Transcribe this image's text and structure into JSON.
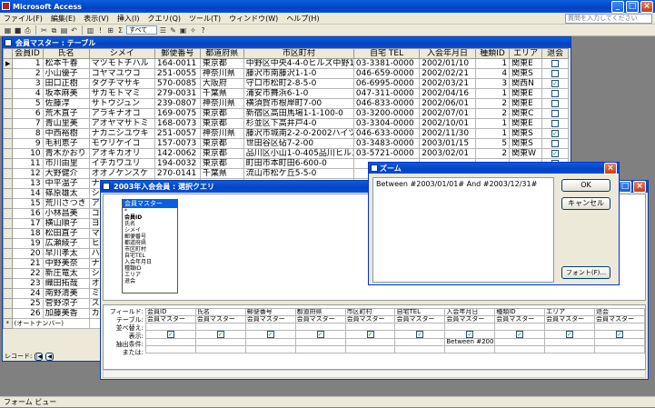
{
  "app": {
    "title": "Microsoft Access",
    "status": "フォーム ビュー"
  },
  "menu": [
    "ファイル(F)",
    "編集(E)",
    "表示(V)",
    "挿入(I)",
    "クエリ(Q)",
    "ツール(T)",
    "ウィンドウ(W)",
    "ヘルプ(H)"
  ],
  "help_placeholder": "質問を入力してください",
  "toolbar": {
    "select_value": "すべて"
  },
  "table_window": {
    "title": "会員マスター : テーブル",
    "columns": [
      "会員ID",
      "氏名",
      "シメイ",
      "郵便番号",
      "都道府県",
      "市区町村",
      "自宅 TEL",
      "入会年月日",
      "種類ID",
      "エリア",
      "退会"
    ],
    "rows": [
      {
        "id": "1",
        "name": "松本千春",
        "kana": "マツモトチハル",
        "zip": "164-0011",
        "pref": "東京都",
        "city": "中野区中央4-4-0ヒルズ中野10",
        "tel": "03-3381-0000",
        "date": "2002/01/10",
        "type": "1",
        "area": "関東E",
        "quit": false
      },
      {
        "id": "2",
        "name": "小山優子",
        "kana": "コヤマユウコ",
        "zip": "251-0055",
        "pref": "神奈川県",
        "city": "藤沢市南藤沢1-1-0",
        "tel": "046-659-0000",
        "date": "2002/02/21",
        "type": "4",
        "area": "関東S",
        "quit": false
      },
      {
        "id": "3",
        "name": "田口正樹",
        "kana": "タグチマサキ",
        "zip": "570-0085",
        "pref": "大阪府",
        "city": "守口市松町2-8-5-0",
        "tel": "06-6995-0000",
        "date": "2002/03/21",
        "type": "3",
        "area": "関西N",
        "quit": true
      },
      {
        "id": "4",
        "name": "坂本麻美",
        "kana": "サカモトマミ",
        "zip": "279-0031",
        "pref": "千葉県",
        "city": "浦安市舞浜6-1-0",
        "tel": "047-311-0000",
        "date": "2002/04/16",
        "type": "1",
        "area": "関東E",
        "quit": false
      },
      {
        "id": "5",
        "name": "佐藤淳",
        "kana": "サトウジュン",
        "zip": "239-0807",
        "pref": "神奈川県",
        "city": "横須賀市根岸町7-00",
        "tel": "046-833-0000",
        "date": "2002/06/01",
        "type": "2",
        "area": "関東E",
        "quit": false
      },
      {
        "id": "6",
        "name": "荒木直子",
        "kana": "アラキナオコ",
        "zip": "169-0075",
        "pref": "東京都",
        "city": "新宿区高田馬場1-1-100-0",
        "tel": "03-3200-0000",
        "date": "2002/07/01",
        "type": "2",
        "area": "関東C",
        "quit": false
      },
      {
        "id": "7",
        "name": "青山里美",
        "kana": "アオヤマサトミ",
        "zip": "168-0073",
        "pref": "東京都",
        "city": "杉並区下高井戸4-0",
        "tel": "03-3304-0000",
        "date": "2002/10/01",
        "type": "1",
        "area": "関東E",
        "quit": false
      },
      {
        "id": "8",
        "name": "中西裕樹",
        "kana": "ナカニシユウキ",
        "zip": "251-0057",
        "pref": "神奈川県",
        "city": "藤沢市城南2-2-0-2002ハイツ城",
        "tel": "046-633-0000",
        "date": "2002/11/30",
        "type": "1",
        "area": "関東S",
        "quit": true
      },
      {
        "id": "9",
        "name": "毛利恵子",
        "kana": "モウリケイコ",
        "zip": "157-0073",
        "pref": "東京都",
        "city": "世田谷区砧7-2-00",
        "tel": "03-3483-0000",
        "date": "2003/01/15",
        "type": "5",
        "area": "関東S",
        "quit": false
      },
      {
        "id": "10",
        "name": "青木かおり",
        "kana": "アオキカオリ",
        "zip": "142-0062",
        "pref": "東京都",
        "city": "品川区小山1-0-405品川ヒルズ",
        "tel": "03-5721-0000",
        "date": "2003/02/01",
        "type": "2",
        "area": "関東W",
        "quit": true
      },
      {
        "id": "11",
        "name": "市川由里",
        "kana": "イチカワユリ",
        "zip": "194-0032",
        "pref": "東京都",
        "city": "町田市本町田6-600-0",
        "tel": "",
        "date": "",
        "type": "",
        "area": "",
        "quit": false
      },
      {
        "id": "12",
        "name": "大野健介",
        "kana": "オオノケンスケ",
        "zip": "270-0141",
        "pref": "千葉県",
        "city": "流山市松ケ丘5-5-0",
        "tel": "",
        "date": "",
        "type": "",
        "area": "",
        "quit": false
      },
      {
        "id": "13",
        "name": "中平温子",
        "kana": "ナ",
        "zip": "",
        "pref": "",
        "city": "",
        "tel": "",
        "date": "",
        "type": "",
        "area": "",
        "quit": false
      },
      {
        "id": "14",
        "name": "篠原雄太",
        "kana": "シ",
        "zip": "",
        "pref": "",
        "city": "",
        "tel": "",
        "date": "",
        "type": "",
        "area": "",
        "quit": false
      },
      {
        "id": "15",
        "name": "荒川さつき",
        "kana": "ア",
        "zip": "",
        "pref": "",
        "city": "",
        "tel": "",
        "date": "",
        "type": "",
        "area": "",
        "quit": false
      },
      {
        "id": "16",
        "name": "小林昌美",
        "kana": "コ",
        "zip": "",
        "pref": "",
        "city": "",
        "tel": "",
        "date": "",
        "type": "",
        "area": "",
        "quit": false
      },
      {
        "id": "17",
        "name": "横山順子",
        "kana": "ヨ",
        "zip": "",
        "pref": "",
        "city": "",
        "tel": "",
        "date": "",
        "type": "",
        "area": "",
        "quit": false
      },
      {
        "id": "18",
        "name": "松田直子",
        "kana": "マ",
        "zip": "",
        "pref": "",
        "city": "",
        "tel": "",
        "date": "",
        "type": "",
        "area": "",
        "quit": false
      },
      {
        "id": "19",
        "name": "広瀬綾子",
        "kana": "ヒ",
        "zip": "",
        "pref": "",
        "city": "",
        "tel": "",
        "date": "",
        "type": "",
        "area": "",
        "quit": false
      },
      {
        "id": "20",
        "name": "早川孝太",
        "kana": "ハ",
        "zip": "",
        "pref": "",
        "city": "",
        "tel": "",
        "date": "",
        "type": "",
        "area": "",
        "quit": false
      },
      {
        "id": "21",
        "name": "中野美奈",
        "kana": "ナ",
        "zip": "",
        "pref": "",
        "city": "",
        "tel": "",
        "date": "",
        "type": "",
        "area": "",
        "quit": false
      },
      {
        "id": "22",
        "name": "新庄竜太",
        "kana": "シ",
        "zip": "",
        "pref": "",
        "city": "",
        "tel": "",
        "date": "",
        "type": "",
        "area": "",
        "quit": false
      },
      {
        "id": "23",
        "name": "織田拓哉",
        "kana": "オ",
        "zip": "",
        "pref": "",
        "city": "",
        "tel": "",
        "date": "",
        "type": "",
        "area": "",
        "quit": false
      },
      {
        "id": "24",
        "name": "南野清美",
        "kana": "ミ",
        "zip": "",
        "pref": "",
        "city": "",
        "tel": "",
        "date": "",
        "type": "",
        "area": "",
        "quit": false
      },
      {
        "id": "25",
        "name": "菅野涼子",
        "kana": "ス",
        "zip": "",
        "pref": "",
        "city": "",
        "tel": "",
        "date": "",
        "type": "",
        "area": "",
        "quit": false
      },
      {
        "id": "26",
        "name": "加藤美香",
        "kana": "カ",
        "zip": "",
        "pref": "",
        "city": "",
        "tel": "",
        "date": "",
        "type": "",
        "area": "",
        "quit": false
      }
    ],
    "new_row_label": "(オートナンバー)",
    "record_label": "レコード:"
  },
  "query_window": {
    "title": "2003年入会会員 : 選択クエリ",
    "field_list_title": "会員マスター",
    "field_list": [
      "*",
      "会員ID",
      "氏名",
      "シメイ",
      "郵便番号",
      "都道府県",
      "市区町村",
      "自宅TEL",
      "入会年月日",
      "種類ID",
      "エリア",
      "退会"
    ],
    "row_labels": [
      "フィールド:",
      "テーブル:",
      "並べ替え:",
      "表示:",
      "抽出条件:",
      "または:"
    ],
    "fields": [
      "会員ID",
      "氏名",
      "郵便番号",
      "都道府県",
      "市区町村",
      "自宅TEL",
      "入会年月日",
      "種類ID",
      "エリア",
      "退会"
    ],
    "table_name": "会員マスター",
    "criteria": "Between #2003/01/0"
  },
  "zoom_dialog": {
    "title": "ズーム",
    "text": "Between #2003/01/01# And #2003/12/31#",
    "ok_label": "OK",
    "cancel_label": "キャンセル",
    "font_label": "フォント(F)..."
  }
}
